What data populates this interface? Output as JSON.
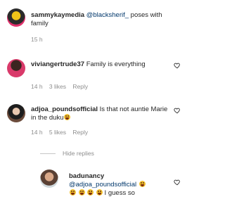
{
  "caption": {
    "username": "sammykaymedia",
    "mention": "@blacksherif_",
    "text": " poses with family",
    "time": "15 h"
  },
  "comments": [
    {
      "username": "viviangertrude37",
      "text": "Family is everything",
      "time": "14 h",
      "likes": "3 likes",
      "reply": "Reply"
    },
    {
      "username": "adjoa_poundsofficial",
      "text": "Is that not auntie Marie in the duku",
      "time": "14 h",
      "likes": "5 likes",
      "reply": "Reply"
    }
  ],
  "hide_replies": "Hide replies",
  "reply": {
    "username": "badunancy",
    "mention": "@adjoa_poundsofficial",
    "text": " I guess so"
  },
  "icons": {
    "heart": "heart-outline-icon",
    "emoji": "laughing-face-emoji"
  }
}
